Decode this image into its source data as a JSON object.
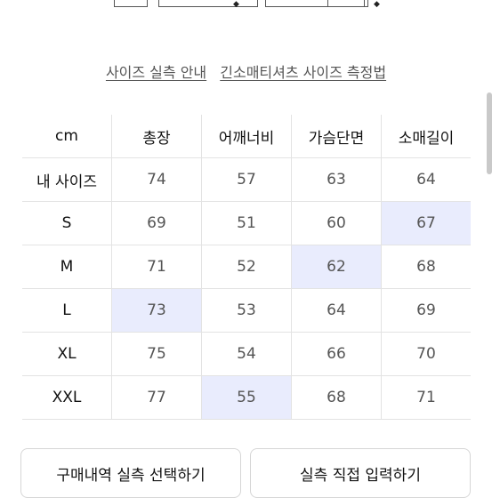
{
  "links": {
    "guide": "사이즈 실측 안내",
    "howto": "긴소매티셔츠 사이즈 측정법"
  },
  "table": {
    "headers": [
      "cm",
      "총장",
      "어깨너비",
      "가슴단면",
      "소매길이"
    ],
    "rows": [
      {
        "size": "내 사이즈",
        "values": [
          "74",
          "57",
          "63",
          "64"
        ]
      },
      {
        "size": "S",
        "values": [
          "69",
          "51",
          "60",
          "67"
        ]
      },
      {
        "size": "M",
        "values": [
          "71",
          "52",
          "62",
          "68"
        ]
      },
      {
        "size": "L",
        "values": [
          "73",
          "53",
          "64",
          "69"
        ]
      },
      {
        "size": "XL",
        "values": [
          "75",
          "54",
          "66",
          "70"
        ]
      },
      {
        "size": "XXL",
        "values": [
          "77",
          "55",
          "68",
          "71"
        ]
      }
    ],
    "highlight_color": "#e9ecfd"
  },
  "buttons": {
    "select_history": "구매내역 실측 선택하기",
    "manual_input": "실측 직접 입력하기"
  }
}
